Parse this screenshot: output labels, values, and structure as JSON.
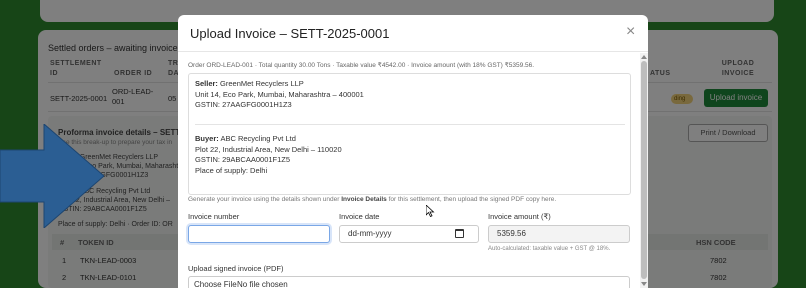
{
  "background": {
    "panel_title": "Settled orders – awaiting invoice u",
    "columns": {
      "settlement_id_1": "SETTLEMENT",
      "settlement_id_2": "ID",
      "order_id": "ORDER ID",
      "tr_1": "TR",
      "tr_2": "DA",
      "status": "ATUS",
      "upload_1": "UPLOAD",
      "upload_2": "INVOICE"
    },
    "row": {
      "settlement_id": "SETT-2025-0001",
      "order_id_1": "ORD-LEAD-",
      "order_id_2": "001",
      "date_partial": "05",
      "badge": "ding",
      "upload_button": "Upload invoice"
    },
    "proforma": {
      "title": "Proforma invoice details – SETT-2",
      "hint": "Use this break-up to prepare your tax in",
      "seller_line1": "Seller: GreenMet Recyclers LLP",
      "seller_line2": "Unit 14, Eco Park, Mumbai, Maharasht",
      "seller_line3": "GSTIN: 27AAGFG0001H1Z3",
      "buyer_line1": "Buyer: ABC Recycling Pvt Ltd",
      "buyer_line2": "Plot 22, Industrial Area, New Delhi –",
      "buyer_line3": "GSTIN: 29ABCAA0001F1Z5",
      "place_line": "Place of supply: Delhi · Order ID: OR",
      "print_button": "Print / Download"
    },
    "token_table": {
      "headers": [
        "#",
        "TOKEN ID",
        "HSN CODE"
      ],
      "rows": [
        {
          "num": "1",
          "token": "TKN-LEAD-0003",
          "hsn": "7802"
        },
        {
          "num": "2",
          "token": "TKN-LEAD-0101",
          "hsn": "7802"
        }
      ]
    }
  },
  "modal": {
    "title": "Upload Invoice – SETT-2025-0001",
    "close_icon": "×",
    "summary": "Order ORD-LEAD-001 · Total quantity 30.00 Tons · Taxable value ₹4542.00 · Invoice amount (with 18% GST) ₹5359.56.",
    "seller": {
      "label": "Seller:",
      "name": "GreenMet Recyclers LLP",
      "address": "Unit 14, Eco Park, Mumbai, Maharashtra – 400001",
      "gstin": "GSTIN: 27AAGFG0001H1Z3"
    },
    "buyer": {
      "label": "Buyer:",
      "name": "ABC Recycling Pvt Ltd",
      "address": "Plot 22, Industrial Area, New Delhi – 110020",
      "gstin": "GSTIN: 29ABCAA0001F1Z5",
      "place": "Place of supply: Delhi"
    },
    "help_prefix": "Generate your invoice using the details shown under",
    "help_bold": "Invoice Details",
    "help_suffix": "for this settlement, then upload the signed PDF copy here.",
    "invoice_number_label": "Invoice number",
    "invoice_number_value": "",
    "invoice_date_label": "Invoice date",
    "invoice_date_placeholder": "dd-mm-yyyy",
    "invoice_amount_label": "Invoice amount (₹)",
    "invoice_amount_value": "5359.56",
    "auto_note": "Auto-calculated: taxable value + GST @ 18%.",
    "upload_label": "Upload signed invoice (PDF)",
    "file_button": "Choose File",
    "file_status": "No file chosen"
  },
  "colors": {
    "brand_green": "#2e8b2e",
    "arrow_blue": "#2b5e93",
    "primary_button": "#1f8a3b"
  },
  "icons": {
    "close": "close-icon",
    "calendar": "calendar-icon",
    "arrow": "arrow-right-icon",
    "cursor": "mouse-cursor-icon"
  }
}
